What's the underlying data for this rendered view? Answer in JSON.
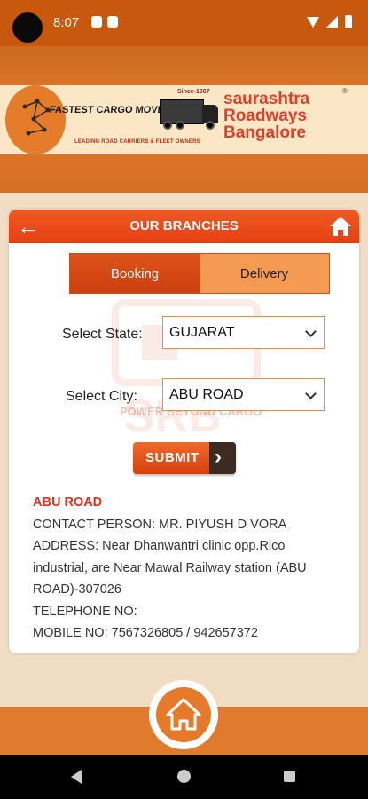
{
  "status_bar": {
    "time": "8:07"
  },
  "banner": {
    "tagline": "FASTEST CARGO MOVERS",
    "since": "Since-1967",
    "subtagline": "LEADING ROAD CARRIERS & FLEET OWNERS",
    "company_line1": "saurashtra",
    "company_line2": "Roadways",
    "company_line3": "Bangalore",
    "registered": "®"
  },
  "header": {
    "title": "OUR BRANCHES"
  },
  "tabs": [
    {
      "label": "Booking",
      "active": true
    },
    {
      "label": "Delivery",
      "active": false
    }
  ],
  "form": {
    "state_label": "Select State:",
    "state_value": "GUJARAT",
    "city_label": "Select City:",
    "city_value": "ABU ROAD",
    "submit_label": "SUBMIT"
  },
  "watermark": {
    "text": "POWER BEYOND CARGO"
  },
  "branch": {
    "city": "ABU ROAD",
    "contact": "CONTACT PERSON: MR. PIYUSH D VORA",
    "address": "ADDRESS: Near Dhanwantri clinic opp.Rico industrial, are Near Mawal Railway station (ABU ROAD)-307026",
    "telephone": "TELEPHONE NO:",
    "mobile": "MOBILE NO: 7567326805 / 942657372"
  },
  "colors": {
    "accent": "#e63f14",
    "orange": "#e07a2c",
    "city_red": "#e0301e"
  }
}
